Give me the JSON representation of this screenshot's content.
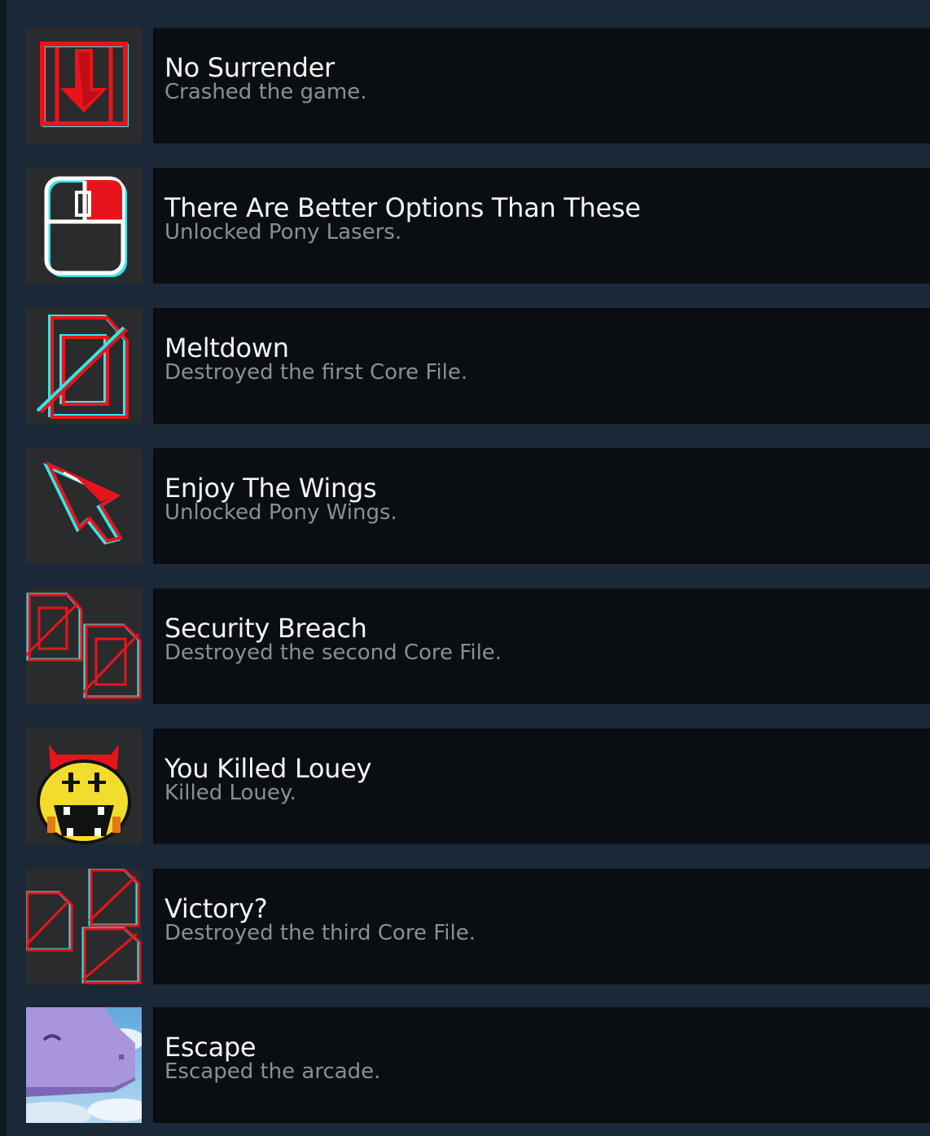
{
  "achievements": [
    {
      "title": "No Surrender",
      "description": "Crashed the game.",
      "icon": "red-arrow-box-icon"
    },
    {
      "title": "There Are Better Options Than These",
      "description": "Unlocked Pony Lasers.",
      "icon": "mouse-icon"
    },
    {
      "title": "Meltdown",
      "description": "Destroyed the first Core File.",
      "icon": "broken-core-file-icon"
    },
    {
      "title": "Enjoy The Wings",
      "description": "Unlocked Pony Wings.",
      "icon": "wing-icon"
    },
    {
      "title": "Security Breach",
      "description": "Destroyed the second Core File.",
      "icon": "two-broken-core-files-icon"
    },
    {
      "title": "You Killed Louey",
      "description": "Killed Louey.",
      "icon": "louey-devil-face-icon"
    },
    {
      "title": "Victory?",
      "description": "Destroyed the third Core File.",
      "icon": "three-broken-core-files-icon"
    },
    {
      "title": "Escape",
      "description": "Escaped the arcade.",
      "icon": "pony-in-sky-icon"
    }
  ],
  "colors": {
    "background": "#1b2838",
    "card": "#0a0d12",
    "title": "#f4f4f4",
    "description": "#8b8f94",
    "glitch_red": "#e8141c",
    "glitch_cyan": "#33e6e6"
  }
}
